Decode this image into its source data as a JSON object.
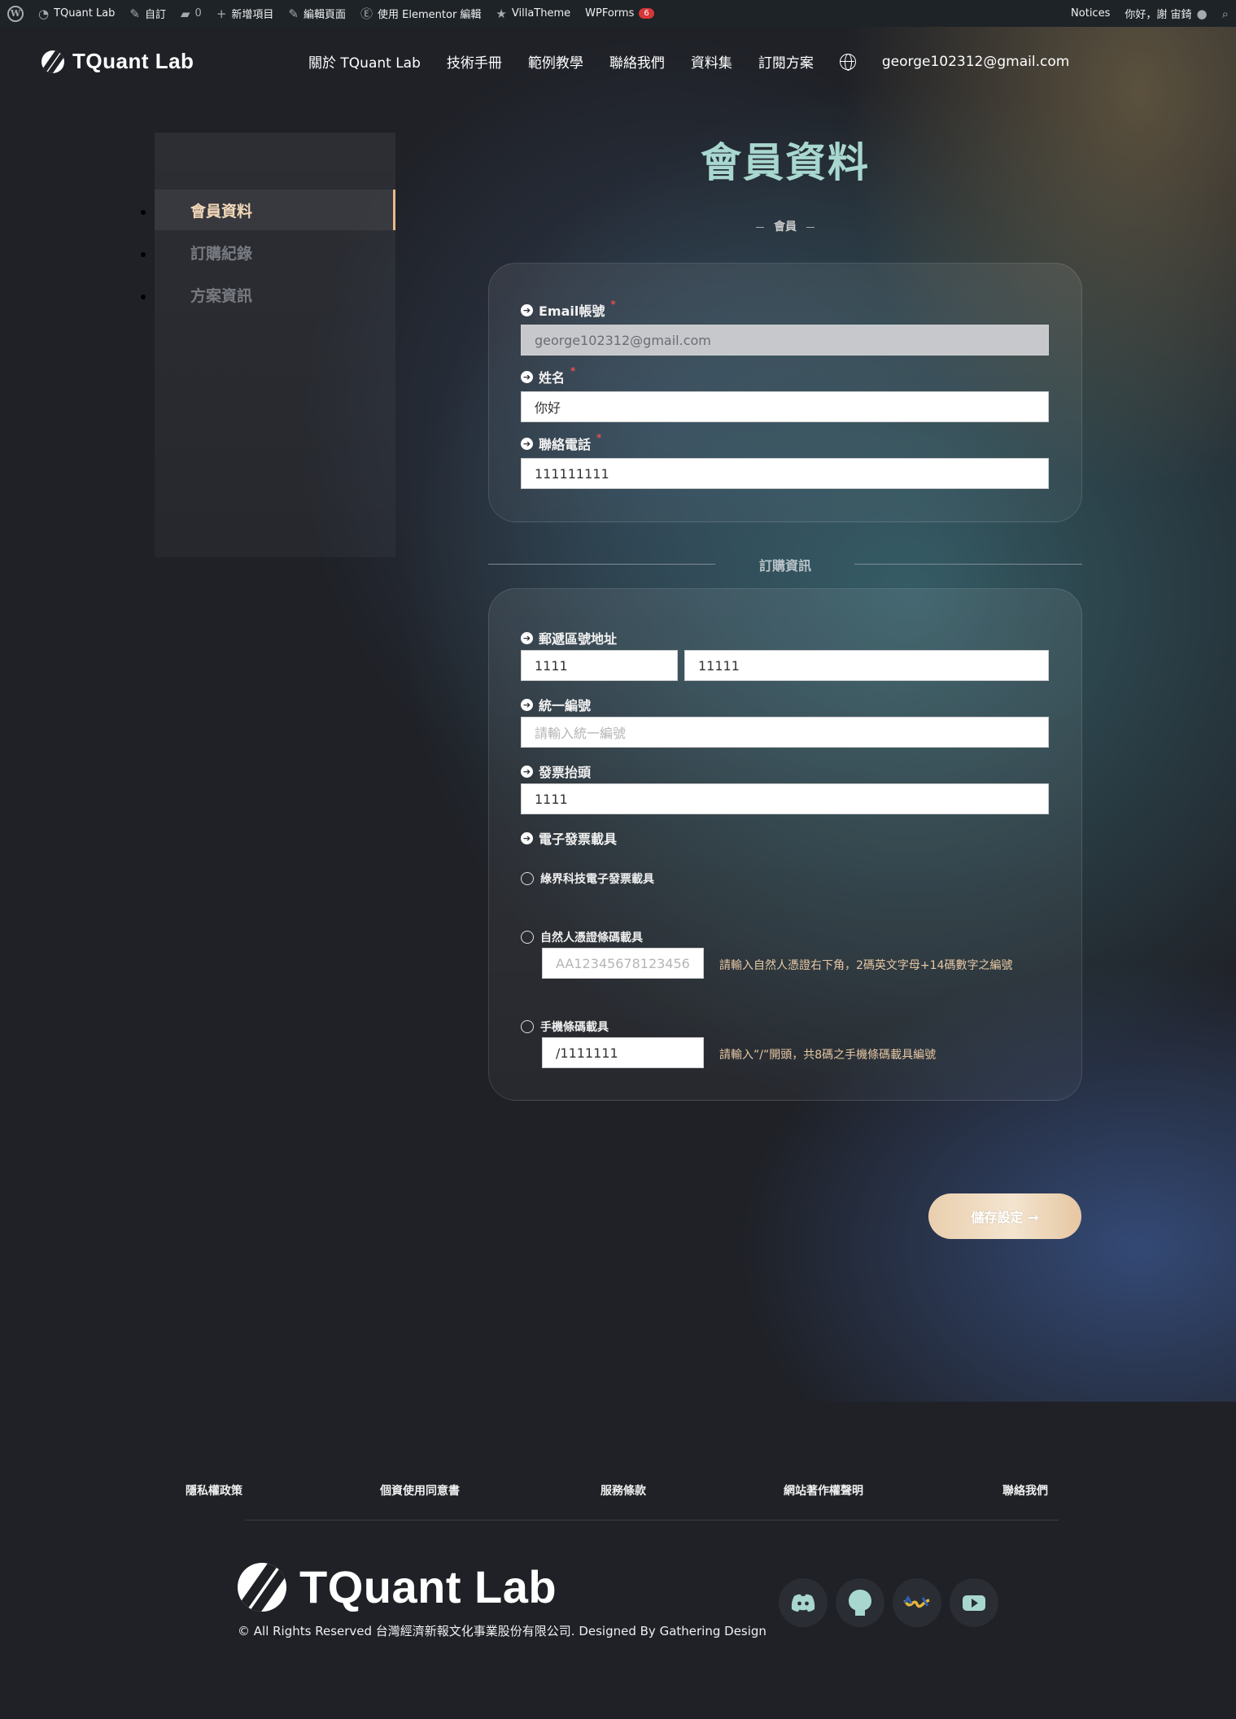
{
  "admin_bar": {
    "site_name": "TQuant Lab",
    "customize": "自訂",
    "comments_count": "0",
    "new_item": "新增項目",
    "edit_page": "編輯頁面",
    "elementor_edit": "使用 Elementor 編輯",
    "villatheme": "VillaTheme",
    "wpforms": "WPForms",
    "wpforms_badge": "6",
    "notices": "Notices",
    "greeting": "你好，謝 宙錡"
  },
  "header": {
    "logo_text": "TQuant Lab",
    "nav": [
      "關於 TQuant Lab",
      "技術手冊",
      "範例教學",
      "聯絡我們",
      "資料集",
      "訂閱方案"
    ],
    "user_email": "george102312@gmail.com"
  },
  "sidebar": {
    "items": [
      {
        "label": "會員資料",
        "active": true
      },
      {
        "label": "訂購紀錄",
        "active": false
      },
      {
        "label": "方案資訊",
        "active": false
      }
    ]
  },
  "main": {
    "title": "會員資料",
    "subtitle": "會員",
    "member": {
      "email_label": "Email帳號",
      "email_value": "george102312@gmail.com",
      "name_label": "姓名",
      "name_value": "你好",
      "phone_label": "聯絡電話",
      "phone_value": "111111111",
      "required_mark": "*"
    },
    "order_section_title": "訂購資訊",
    "order": {
      "address_label": "郵遞區號地址",
      "zip_value": "1111",
      "address_value": "11111",
      "tax_id_label": "統一編號",
      "tax_id_placeholder": "請輸入統一編號",
      "invoice_title_label": "發票抬頭",
      "invoice_title_value": "1111",
      "e_invoice_label": "電子發票載具",
      "carrier_options": [
        {
          "label": "綠界科技電子發票載具"
        },
        {
          "label": "自然人憑證條碼載具",
          "placeholder": "AA12345678123456",
          "hint": "請輸入自然人憑證右下角，2碼英文字母+14碼數字之編號"
        },
        {
          "label": "手機條碼載具",
          "value": "/1111111",
          "hint": "請輸入”/”開頭，共8碼之手機條碼載具編號"
        }
      ]
    },
    "save_button": "儲存設定 →"
  },
  "footer": {
    "links": [
      "隱私權政策",
      "個資使用同意書",
      "服務條款",
      "網站著作權聲明",
      "聯絡我們"
    ],
    "logo_text": "TQuant Lab",
    "copyright": "© All Rights Reserved 台灣經濟新報文化事業股份有限公司. Designed By Gathering Design",
    "social_icons": [
      "discord-icon",
      "github-icon",
      "tej-icon",
      "youtube-icon"
    ]
  },
  "colors": {
    "title": "#a8d7cf",
    "active_sidebar": "#f2d7b8",
    "hint": "#e8c9a4",
    "button": "#f0dcc2"
  }
}
